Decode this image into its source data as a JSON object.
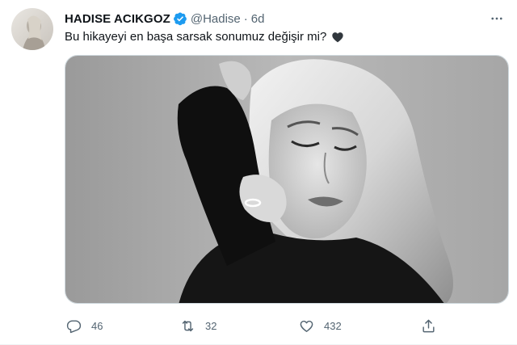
{
  "tweet": {
    "display_name": "HADISE ACIKGOZ",
    "handle": "@Hadise",
    "separator": "·",
    "time": "6d",
    "text": "Bu hikayeyi en başa sarsak sonumuz değişir mi?",
    "emoji": "black-heart-icon",
    "verified": true
  },
  "actions": {
    "reply_count": "46",
    "retweet_count": "32",
    "like_count": "432"
  },
  "colors": {
    "verified_blue": "#1d9bf0",
    "muted_text": "#536471",
    "text": "#0f1419",
    "border": "#cfd9de"
  },
  "icons": [
    "more-icon",
    "verified-badge-icon",
    "reply-icon",
    "retweet-icon",
    "like-icon",
    "share-icon"
  ]
}
